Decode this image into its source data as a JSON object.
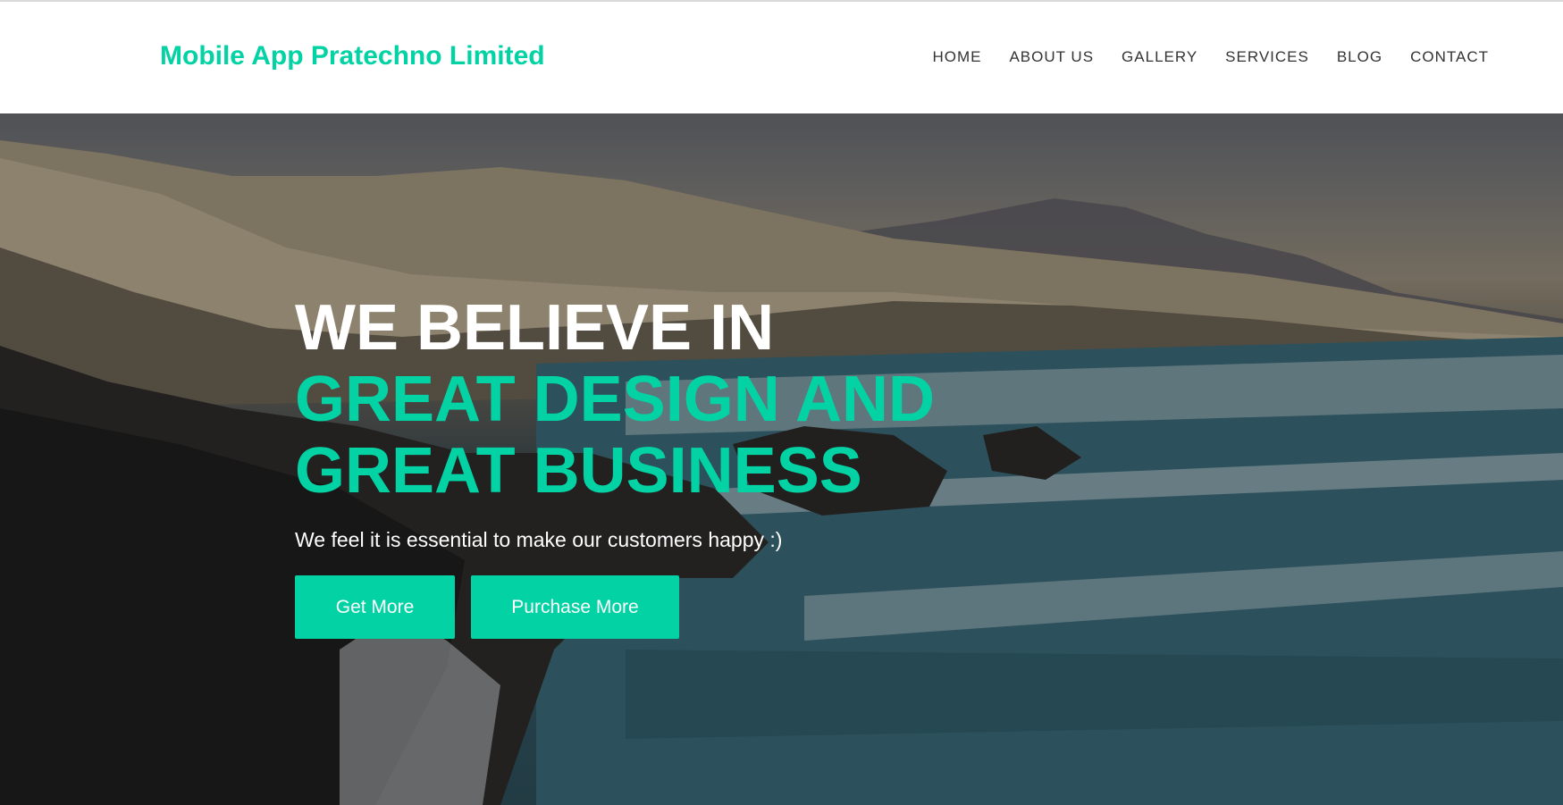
{
  "header": {
    "brand": "Mobile App Pratechno Limited",
    "nav": [
      "HOME",
      "ABOUT US",
      "GALLERY",
      "SERVICES",
      "BLOG",
      "CONTACT"
    ]
  },
  "hero": {
    "line1": "WE BELIEVE IN",
    "line2": "GREAT DESIGN AND",
    "line3": "GREAT BUSINESS",
    "tagline": "We feel it is essential to make our customers happy :)",
    "buttons": {
      "primary": "Get More",
      "secondary": "Purchase More"
    }
  },
  "colors": {
    "accent": "#03d3a4",
    "nav_text": "#333333",
    "hero_heading": "#ffffff"
  }
}
